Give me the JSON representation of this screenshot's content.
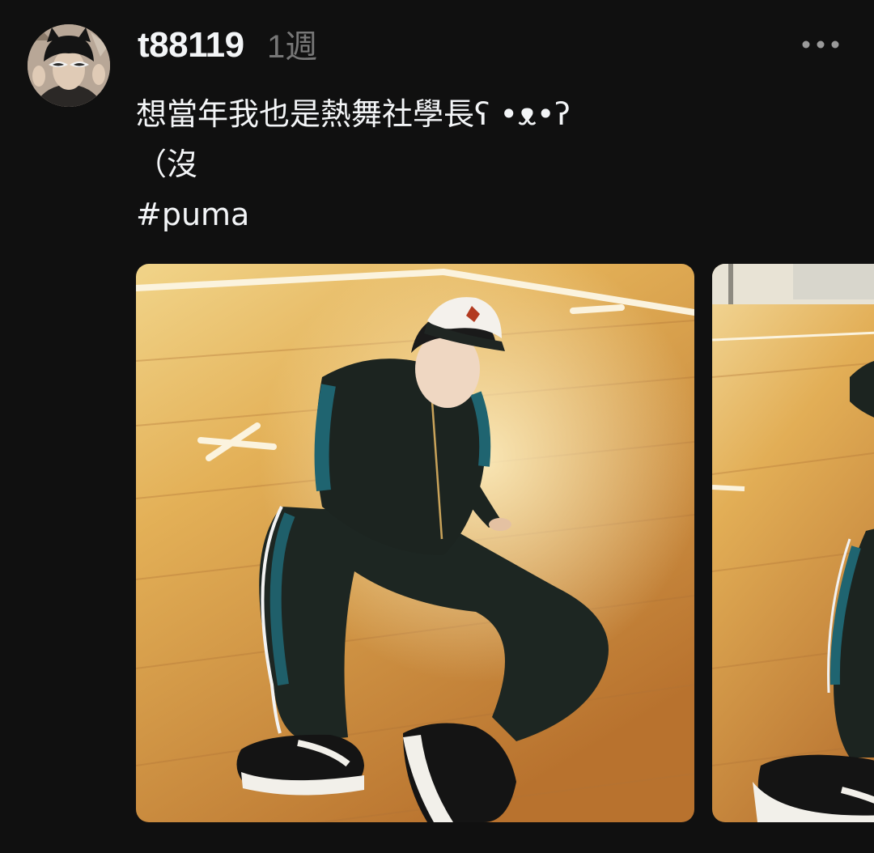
{
  "post": {
    "username": "t88119",
    "timestamp": "1週",
    "caption_lines": [
      "想當年我也是熱舞社學長ʕ •ᴥ•ʔ",
      "（沒"
    ],
    "hashtag": "#puma"
  },
  "media": {
    "photo_count_visible": 2,
    "items": [
      {
        "kind": "photo",
        "subject": "person-sitting-on-gym-floor"
      },
      {
        "kind": "photo",
        "subject": "person-sitting-on-gym-floor-partial"
      }
    ]
  },
  "colors": {
    "background": "#101010",
    "text_primary": "#f3f5f7",
    "text_secondary": "#777777"
  }
}
